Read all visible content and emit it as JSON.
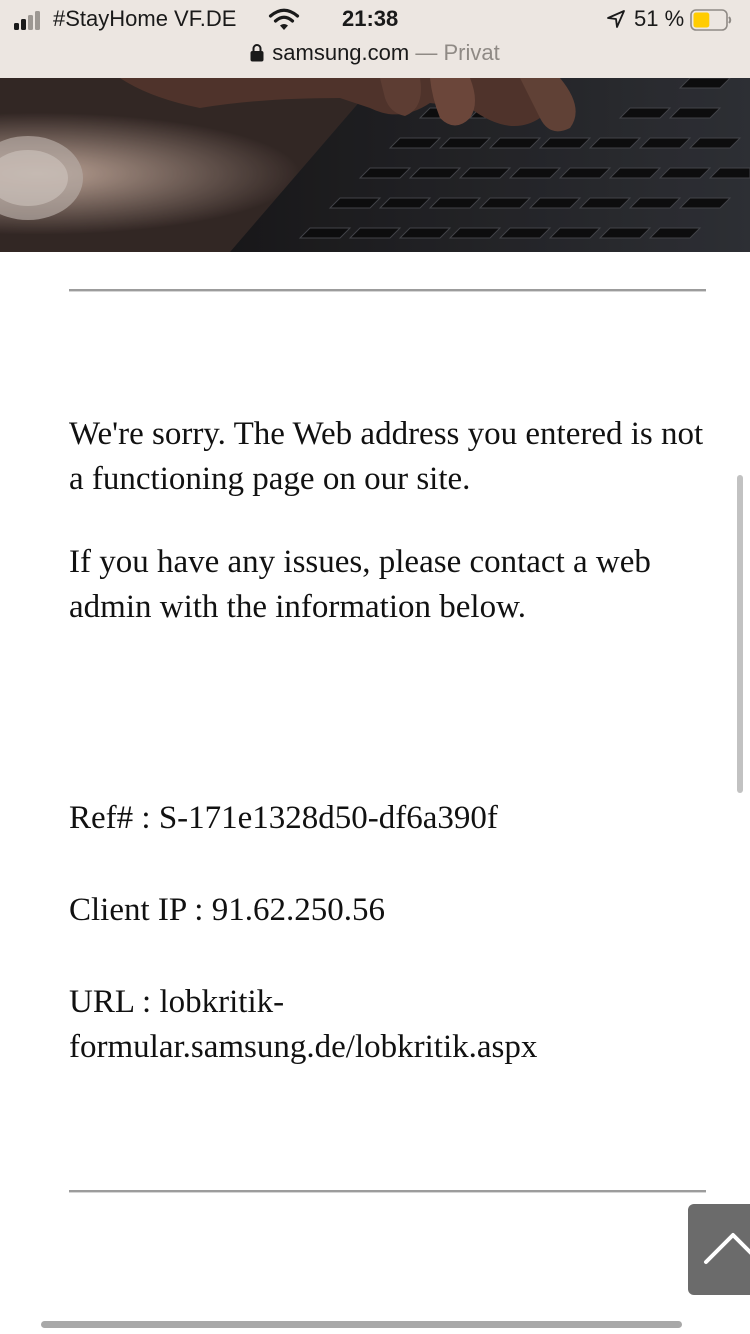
{
  "status_bar": {
    "carrier": "#StayHome VF.DE",
    "time": "21:38",
    "battery_percent": "51 %",
    "battery_level": 0.51,
    "signal_bars_active": 2,
    "signal_bars_total": 4,
    "icons": [
      "signal-icon",
      "wifi-icon",
      "location-arrow-icon",
      "battery-icon"
    ]
  },
  "address_bar": {
    "domain": "samsung.com",
    "separator": "—",
    "mode": "Privat",
    "icon": "lock-icon"
  },
  "hero": {
    "description_icon": "keyboard-photo"
  },
  "error": {
    "message": "We're sorry. The Web address you entered is not a functioning page on our site.",
    "instruction": "If you have any issues, please contact a web admin with the information below."
  },
  "details": {
    "ref": "Ref# : S-171e1328d50-df6a390f",
    "client_ip": "Client IP : 91.62.250.56",
    "url_line1": "URL : lobkritik-",
    "url_line2": "formular.samsung.de/lobkritik.aspx"
  },
  "back_to_top": {
    "icon": "chevron-up-icon"
  },
  "colors": {
    "status_bg": "#ece6e1",
    "battery_fill": "#ffcc00",
    "button_bg": "#6b6b6b"
  }
}
